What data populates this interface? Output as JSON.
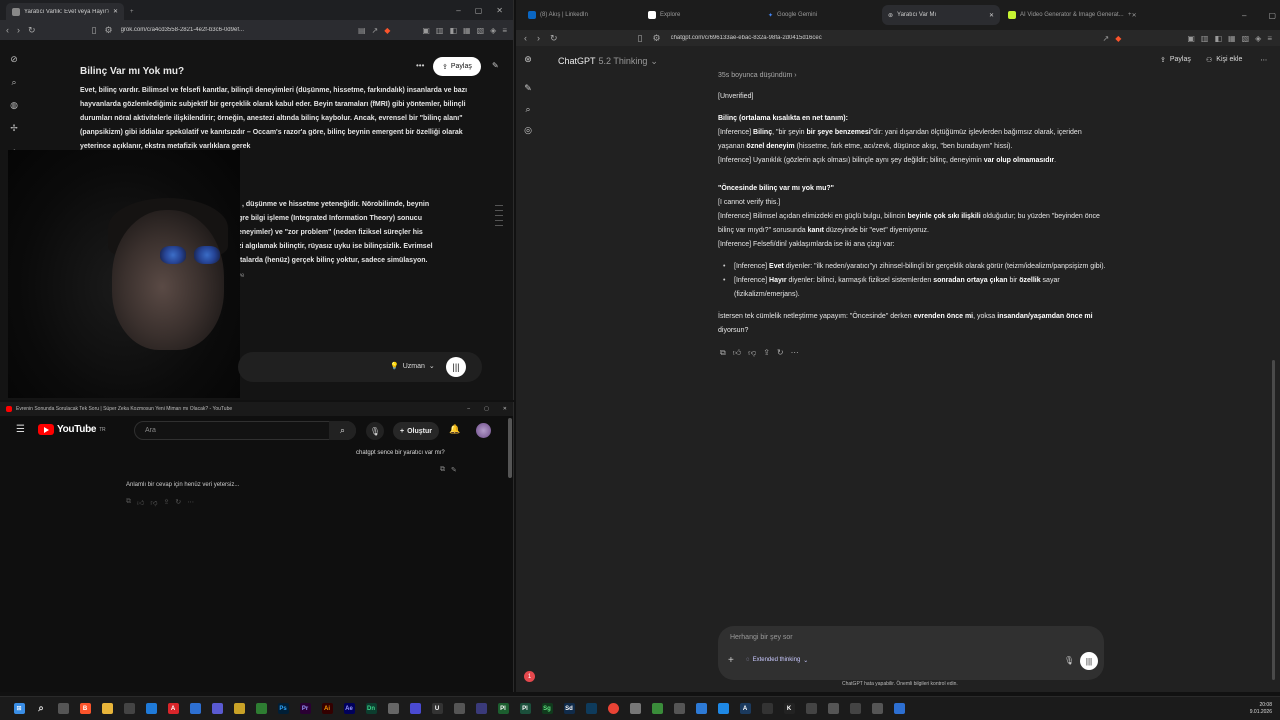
{
  "grok": {
    "tabs": [
      {
        "label": "Yaratıcı Varlık: Evet veya Hayır?",
        "active": true
      },
      {
        "label": "",
        "active": false
      }
    ],
    "url": "grok.com/c/a4cd3558-2821-4e2f-b3c6-0d9ef...",
    "title": "Bilinç Var mı Yok mu?",
    "share_label": "Paylaş",
    "paragraph1": "Evet, bilinç vardır. Bilimsel ve felsefi kanıtlar, bilinçli deneyimleri (düşünme, hissetme, farkındalık) insanlarda ve bazı hayvanlarda gözlemlediğimiz subjektif bir gerçeklik olarak kabul eder. Beyin taramaları (fMRI) gibi yöntemler, bilinçli durumları nöral aktivitelerle ilişkilendirir; örneğin, anestezi altında bilinç kaybolur. Ancak, evrensel bir \"bilinç alanı\" (panpsikizm) gibi iddialar spekülatif ve kanıtsızdır – Occam's razor'a göre, bilinç beynin emergent bir özelliği olarak yeterince açıklanır, ekstra metafizik varlıklara gerek",
    "heading_fragment": ")",
    "paragraph2_lines": [
      ", düşünme ve hissetme yeteneğidir. Nörobilimde, beynin",
      "gre bilgi işleme (Integrated Information Theory) sonucu",
      "eneyimler) ve \"zor problem\" (neden fiziksel süreçler his",
      "zi algılamak bilinçtir, rüyasız uyku ise bilinçsizlik. Evrimsel",
      "ıtalarda (henüz) gerçek bilinç yoktur, sadece simülasyon."
    ],
    "fragment_ye": "ye",
    "mode_label": "Uzman"
  },
  "youtube": {
    "window_title": "Evrenin Sonunda Sorulacak Tek Soru | Süper Zeka Kozmosun Yeni Mimarı mı Olacak? - YouTube",
    "logo_text": "YouTube",
    "logo_region": "TR",
    "search_placeholder": "Ara",
    "create_label": "Oluştur",
    "user_message": "chatgpt sence bir yaratıcı var mı?",
    "assistant_message": "Anlamlı bir cevap için henüz veri yetersiz..."
  },
  "chatgpt": {
    "tabs": [
      {
        "label": "(8) Akış | LinkedIn",
        "color": "#0a66c2"
      },
      {
        "label": "Explore",
        "color": "#ffffff"
      },
      {
        "label": "Google Gemini",
        "color": "#4285f4"
      },
      {
        "label": "Yaratıcı Var Mı",
        "color": "#aaaaaa",
        "active": true
      },
      {
        "label": "AI Video Generator & Image Generat...",
        "color": "#c6f432"
      }
    ],
    "url": "chatgpt.com/c/696133ae-ebac-832a-98fa-2d0415d16cec",
    "model_name": "ChatGPT",
    "model_version": "5.2 Thinking",
    "share_label": "Paylaş",
    "add_person_label": "Kişi ekle",
    "thought_label": "35s boyunca düşündüm",
    "composer_placeholder": "Herhangi bir şey sor",
    "mode_label": "Extended thinking",
    "footer_note": "ChatGPT hata yapabilir. Önemli bilgileri kontrol edin.",
    "notification_count": "1"
  },
  "taskbar": {
    "time": "20:08",
    "date": "9.01.2026"
  }
}
